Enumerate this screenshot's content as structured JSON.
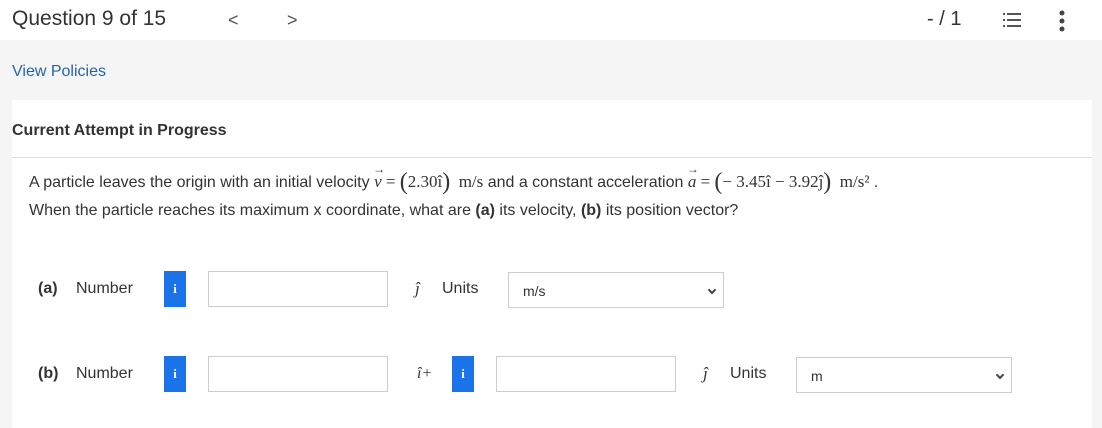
{
  "header": {
    "question_title": "Question 9 of 15",
    "prev_arrow": "<",
    "next_arrow": ">",
    "score": "- / 1",
    "list_icon": "list-icon",
    "more_icon": "more-vertical-icon"
  },
  "view_policies": "View Policies",
  "attempt_heading": "Current Attempt in Progress",
  "problem": {
    "text_1": "A particle leaves the origin with an initial velocity ",
    "v_symbol": "v",
    "equals": "=",
    "v_value": "2.30î",
    "v_unit": "m/s",
    "text_2": " and a constant acceleration ",
    "a_symbol": "a",
    "a_value": "− 3.45î − 3.92ĵ",
    "a_unit": "m/s²",
    "period": ".",
    "line_2_a": "When the particle reaches its maximum x coordinate, what are ",
    "part_a": "(a)",
    "line_2_b": " its velocity, ",
    "part_b": "(b)",
    "line_2_c": " its position vector?"
  },
  "part_a_row": {
    "label": "(a)",
    "number_label": "Number",
    "info_label": "i",
    "input_value": "",
    "unit_vector": "ĵ",
    "units_label": "Units",
    "units_selected": "m/s"
  },
  "part_b_row": {
    "label": "(b)",
    "number_label": "Number",
    "info_label": "i",
    "input_value": "",
    "unit_vector_1": "î+",
    "info_label_2": "i",
    "input_value_2": "",
    "unit_vector_2": "ĵ",
    "units_label": "Units",
    "units_selected": "m"
  },
  "colors": {
    "info_button": "#1a73e8",
    "link": "#2266aa",
    "page_background": "#f5f5f5"
  }
}
